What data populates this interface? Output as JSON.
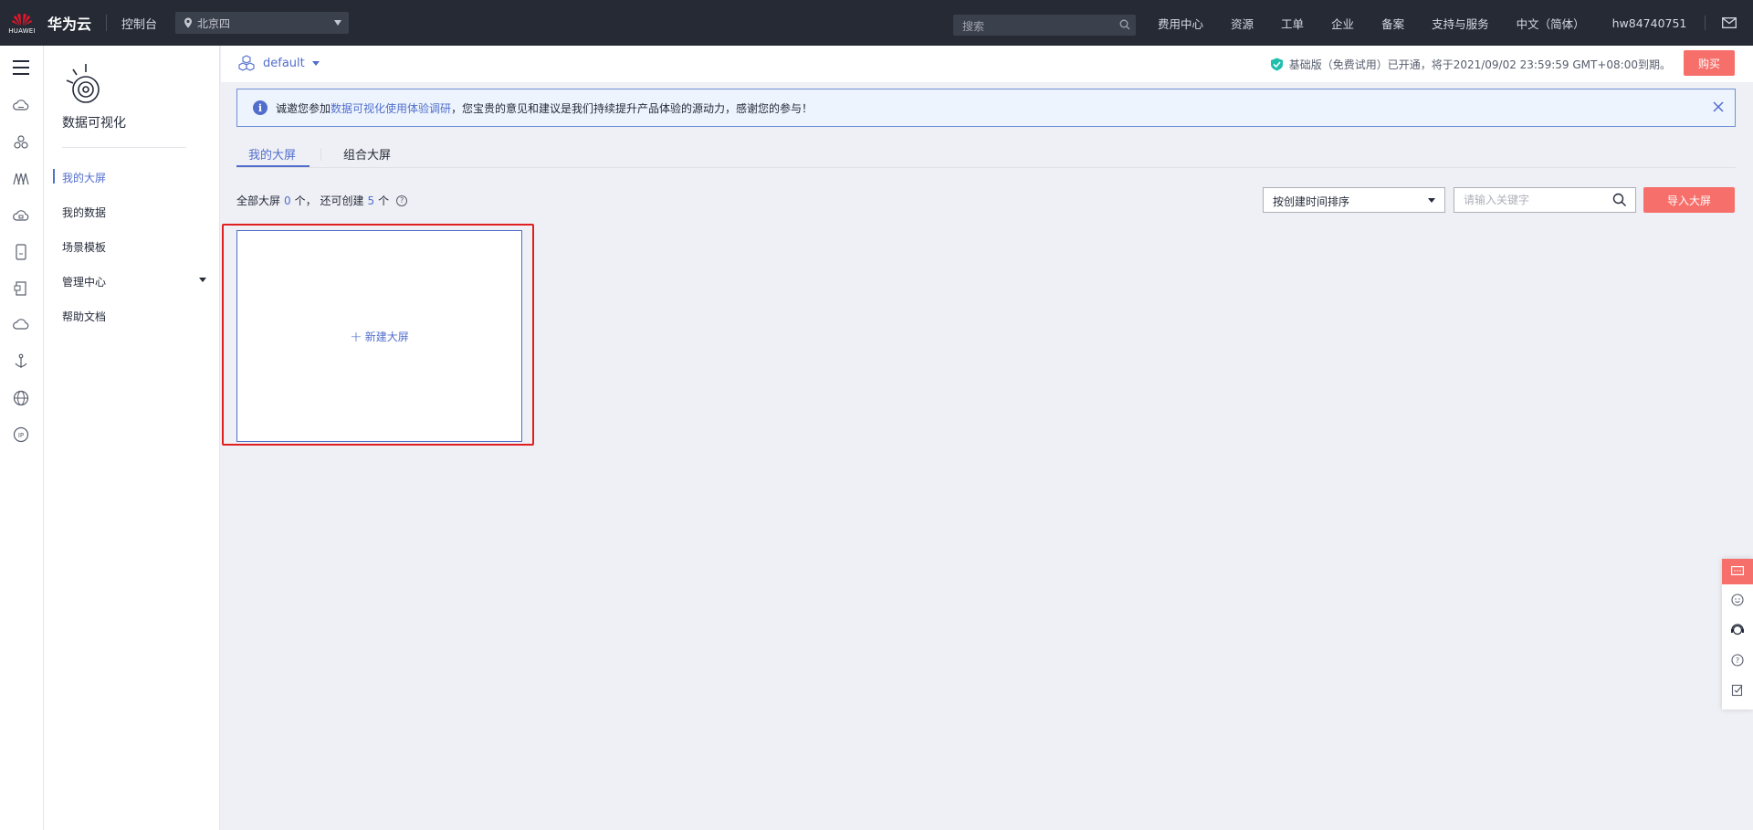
{
  "topbar": {
    "logo_text": "HUAWEI",
    "brand": "华为云",
    "console": "控制台",
    "region": "北京四",
    "search_placeholder": "搜索",
    "nav": [
      "费用中心",
      "资源",
      "工单",
      "企业",
      "备案",
      "支持与服务",
      "中文（简体）"
    ],
    "user": "hw84740751"
  },
  "sidebar": {
    "service_title": "数据可视化",
    "items": [
      {
        "label": "我的大屏",
        "active": true
      },
      {
        "label": "我的数据",
        "active": false
      },
      {
        "label": "场景模板",
        "active": false
      },
      {
        "label": "管理中心",
        "active": false,
        "expandable": true
      },
      {
        "label": "帮助文档",
        "active": false
      }
    ]
  },
  "subheader": {
    "project": "default",
    "trial_text": "基础版（免费试用）已开通，将于2021/09/02 23:59:59 GMT+08:00到期。",
    "buy_label": "购买"
  },
  "notice": {
    "prefix": "诚邀您参加",
    "link": "数据可视化使用体验调研",
    "suffix": "，您宝贵的意见和建议是我们持续提升产品体验的源动力，感谢您的参与！"
  },
  "tabs": [
    {
      "label": "我的大屏",
      "active": true
    },
    {
      "label": "组合大屏",
      "active": false
    }
  ],
  "summary": {
    "prefix": "全部大屏",
    "total": "0",
    "mid": "个， 还可创建",
    "remaining": "5",
    "suffix": "个"
  },
  "toolbar": {
    "sort_value": "按创建时间排序",
    "keyword_placeholder": "请输入关键字",
    "import_label": "导入大屏"
  },
  "new_card": {
    "plus": "+",
    "label": "新建大屏"
  },
  "colors": {
    "accent": "#526ecc",
    "primary_button": "#f66f6a",
    "highlight": "#e02020",
    "topbar": "#252a35"
  }
}
